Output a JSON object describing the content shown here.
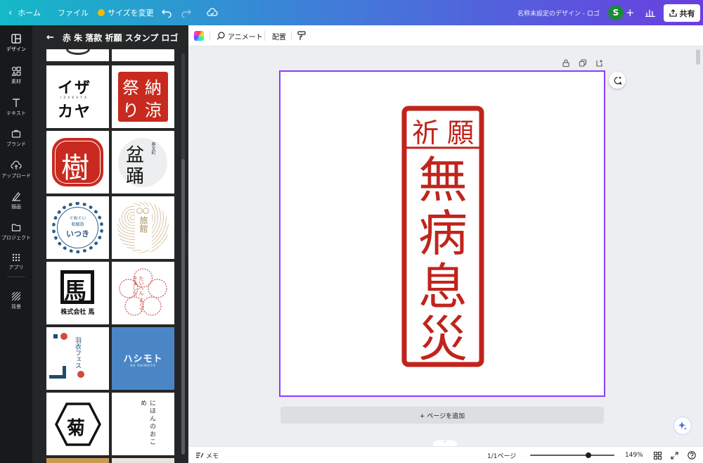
{
  "topbar": {
    "home_label": "ホーム",
    "file_label": "ファイル",
    "resize_label": "サイズを変更",
    "doc_title": "名称未設定のデザイン - ロゴ",
    "avatar_initial": "S",
    "share_label": "共有"
  },
  "rail": {
    "items": [
      {
        "label": "デザイン"
      },
      {
        "label": "素材"
      },
      {
        "label": "テキスト"
      },
      {
        "label": "ブランド"
      },
      {
        "label": "アップロード"
      },
      {
        "label": "描画"
      },
      {
        "label": "プロジェクト"
      },
      {
        "label": "アプリ"
      },
      {
        "label": "背景"
      }
    ]
  },
  "panel": {
    "title": "赤 朱 落款 祈願 スタンプ ロゴ",
    "tiles": [
      {
        "main": "イザ カヤ",
        "l1": "イザ",
        "l2": "カヤ",
        "sub": "I Z A K A Y A"
      },
      {
        "c1": "納",
        "c2": "祭",
        "c3": "涼",
        "c4": "り"
      },
      {
        "char": "樹"
      },
      {
        "top": "盆",
        "bot": "踊",
        "side": "祭文町"
      },
      {
        "top": "ぐぬぐい",
        "mid": "和雑貨",
        "main": "いつき"
      },
      {
        "top": "〇〇",
        "bot": "旅館"
      },
      {
        "char": "馬",
        "caption": "株式会社 馬"
      },
      {
        "text": "たいへん よくできました"
      },
      {
        "text": "羽衣フェス"
      },
      {
        "text": "ハシモト",
        "sub": "HA SHIMOTO"
      },
      {
        "char": "菊"
      },
      {
        "text": "にほんのおこめ"
      }
    ]
  },
  "toolbar": {
    "animate_label": "アニメート",
    "position_label": "配置"
  },
  "stamp": {
    "top_left": "祈",
    "top_right": "願",
    "chars": [
      "無",
      "病",
      "息",
      "災"
    ],
    "color": "#c0241c"
  },
  "canvas": {
    "add_page_label": "+ ページを追加"
  },
  "bottombar": {
    "notes_label": "メモ",
    "page_count": "1/1ページ",
    "zoom": "149%"
  },
  "colors": {
    "accent": "#8b3dff",
    "stamp_red": "#c0241c"
  }
}
